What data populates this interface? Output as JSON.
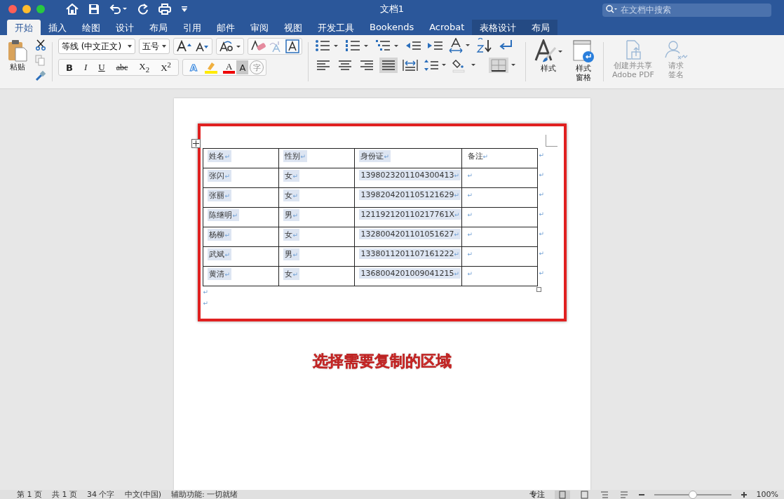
{
  "window": {
    "title": "文档1",
    "search_placeholder": "在文档中搜索"
  },
  "tabs": [
    {
      "label": "开始",
      "selected": true
    },
    {
      "label": "插入",
      "selected": false
    },
    {
      "label": "绘图",
      "selected": false
    },
    {
      "label": "设计",
      "selected": false
    },
    {
      "label": "布局",
      "selected": false
    },
    {
      "label": "引用",
      "selected": false
    },
    {
      "label": "邮件",
      "selected": false
    },
    {
      "label": "审阅",
      "selected": false
    },
    {
      "label": "视图",
      "selected": false
    },
    {
      "label": "开发工具",
      "selected": false
    },
    {
      "label": "Bookends",
      "selected": false
    },
    {
      "label": "Acrobat",
      "selected": false
    },
    {
      "label": "表格设计",
      "selected": false,
      "context": true
    },
    {
      "label": "布局",
      "selected": false,
      "context": true
    }
  ],
  "ribbon": {
    "paste_label": "粘贴",
    "font_name": "等线 (中文正文)",
    "font_size": "五号",
    "format_buttons": [
      "B",
      "I",
      "U",
      "abc",
      "X$_{2}$",
      "X$^{2}$"
    ],
    "char_buttons": [
      "A",
      "A",
      "A",
      "字"
    ],
    "styles_label": "样式",
    "styles_pane_label": [
      "样式",
      "窗格"
    ],
    "adobe": [
      {
        "label": [
          "创建并共享",
          "Adobe PDF"
        ],
        "disabled": true
      },
      {
        "label": [
          "请求",
          "签名"
        ],
        "disabled": true
      }
    ]
  },
  "table": {
    "columns": [
      {
        "text": "姓名",
        "selected": true
      },
      {
        "text": "性别",
        "selected": true
      },
      {
        "text": "身份证",
        "selected": true
      },
      {
        "text": "备注",
        "selected": false
      }
    ],
    "rows": [
      [
        {
          "text": "张闪",
          "selected": true
        },
        {
          "text": "女",
          "selected": true
        },
        {
          "text": "1398023201104300413",
          "selected": true
        },
        {
          "text": "",
          "selected": false
        }
      ],
      [
        {
          "text": "张丽",
          "selected": true
        },
        {
          "text": "女",
          "selected": true
        },
        {
          "text": "1398204201105121629",
          "selected": true
        },
        {
          "text": "",
          "selected": false
        }
      ],
      [
        {
          "text": "陈继明",
          "selected": true
        },
        {
          "text": "男",
          "selected": true
        },
        {
          "text": "121192120110217761X",
          "selected": true
        },
        {
          "text": "",
          "selected": false
        }
      ],
      [
        {
          "text": "杨柳",
          "selected": true
        },
        {
          "text": "女",
          "selected": true
        },
        {
          "text": "1328004201101051627",
          "selected": true
        },
        {
          "text": "",
          "selected": false
        }
      ],
      [
        {
          "text": "武斌",
          "selected": true
        },
        {
          "text": "男",
          "selected": true
        },
        {
          "text": "1338011201107161222",
          "selected": true
        },
        {
          "text": "",
          "selected": false
        }
      ],
      [
        {
          "text": "黄清",
          "selected": true
        },
        {
          "text": "女",
          "selected": true
        },
        {
          "text": "1368004201009041215",
          "selected": true
        },
        {
          "text": "",
          "selected": false
        }
      ]
    ],
    "mark": "↵"
  },
  "annotation": "选择需要复制的区域",
  "status_bar": {
    "left": [
      "第 1 页",
      "共 1 页",
      "34 个字",
      "中文(中国)",
      "辅助功能: 一切就绪"
    ],
    "focus": "专注",
    "zoom": "100%",
    "zoom_slider": {
      "level": 0.5
    }
  }
}
